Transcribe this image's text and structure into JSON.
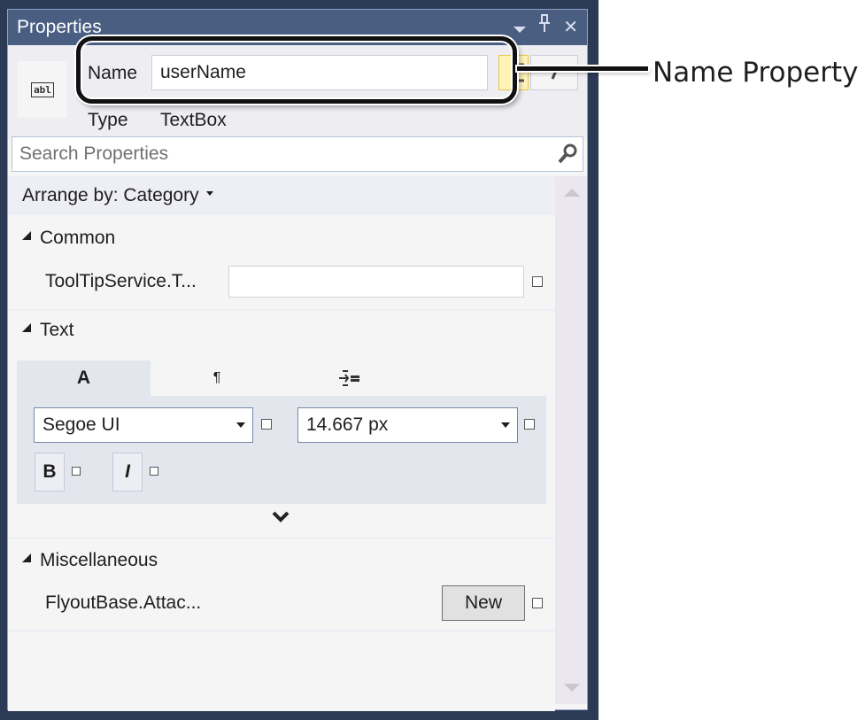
{
  "panel": {
    "title": "Properties",
    "title_actions": [
      "dropdown-icon",
      "pin-icon",
      "close-icon"
    ],
    "close_glyph": "✕",
    "pin_glyph": "⊥"
  },
  "header": {
    "type_icon_text": "abl",
    "name_label": "Name",
    "name_value": "userName",
    "type_label": "Type",
    "type_value": "TextBox"
  },
  "search": {
    "placeholder": "Search Properties"
  },
  "arrange": {
    "label": "Arrange by: Category"
  },
  "categories": {
    "common": {
      "title": "Common",
      "properties": [
        {
          "name": "ToolTipService.T...",
          "value": ""
        }
      ]
    },
    "text": {
      "title": "Text",
      "tabs": [
        {
          "label": "A",
          "icon": "character-icon",
          "active": true
        },
        {
          "label": "¶",
          "icon": "paragraph-icon",
          "active": false
        },
        {
          "label": "⇥",
          "icon": "indent-icon",
          "active": false
        }
      ],
      "font_family": "Segoe UI",
      "font_size": "14.667 px",
      "bold_label": "B",
      "italic_label": "I"
    },
    "misc": {
      "title": "Miscellaneous",
      "properties": [
        {
          "name": "FlyoutBase.Attac...",
          "button": "New"
        }
      ]
    }
  },
  "callout": {
    "label": "Name Property"
  },
  "colors": {
    "titlebar": "#4a5e82",
    "frame": "#2b3a55",
    "highlight": "#fff3b8"
  }
}
